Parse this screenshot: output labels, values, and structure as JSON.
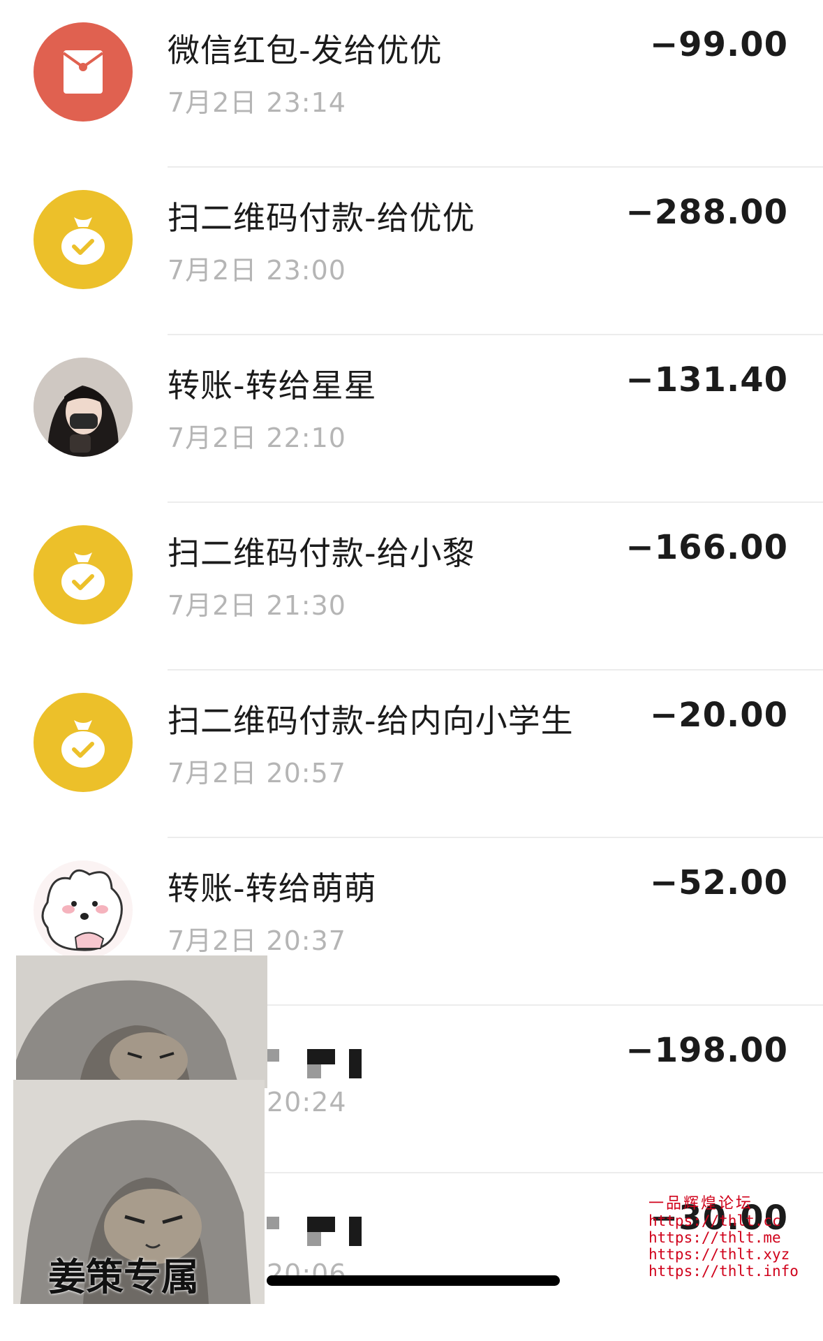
{
  "transactions": [
    {
      "title": "微信红包-发给优优",
      "time": "7月2日 23:14",
      "amount": "−99.00",
      "icon": "red-packet-icon",
      "color": "#e06150"
    },
    {
      "title": "扫二维码付款-给优优",
      "time": "7月2日 23:00",
      "amount": "−288.00",
      "icon": "money-bag-icon",
      "color": "#ecc02a"
    },
    {
      "title": "转账-转给星星",
      "time": "7月2日 22:10",
      "amount": "−131.40",
      "icon": "user-avatar-photo",
      "color": "#5a5a5a"
    },
    {
      "title": "扫二维码付款-给小黎",
      "time": "7月2日 21:30",
      "amount": "−166.00",
      "icon": "money-bag-icon",
      "color": "#ecc02a"
    },
    {
      "title": "扫二维码付款-给内向小学生",
      "time": "7月2日 20:57",
      "amount": "−20.00",
      "icon": "money-bag-icon",
      "color": "#ecc02a"
    },
    {
      "title": "转账-转给萌萌",
      "time": "7月2日 20:37",
      "amount": "−52.00",
      "icon": "cartoon-bunny-avatar",
      "color": "#fbe4e8"
    },
    {
      "title": "",
      "time": "20:24",
      "amount": "−198.00",
      "icon": "obscured",
      "color": "#ffffff"
    },
    {
      "title": "",
      "time": "20:06",
      "amount": "−30.00",
      "icon": "obscured",
      "color": "#ffffff"
    }
  ],
  "sticker": {
    "caption": "姜策专属"
  },
  "watermark": {
    "title": "一品辉煌论坛",
    "lines": [
      "https://thlt.cc",
      "https://thlt.me",
      "https://thlt.xyz",
      "https://thlt.info"
    ]
  }
}
